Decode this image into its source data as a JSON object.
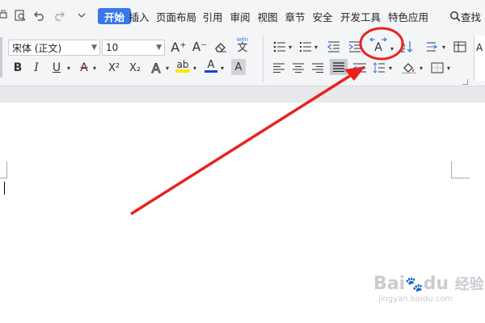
{
  "menubar": {
    "tabs": [
      {
        "label": "开始",
        "active": true
      },
      {
        "label": "插入"
      },
      {
        "label": "页面布局"
      },
      {
        "label": "引用"
      },
      {
        "label": "审阅"
      },
      {
        "label": "视图"
      },
      {
        "label": "章节"
      },
      {
        "label": "安全"
      },
      {
        "label": "开发工具"
      },
      {
        "label": "特色应用"
      }
    ],
    "search_label": "查找"
  },
  "font": {
    "name": "宋体 (正文)",
    "size": "10"
  },
  "format": {
    "bold": "B",
    "italic": "I",
    "underline": "U",
    "strike": "A",
    "superscript": "X²",
    "subscript": "X₂",
    "effects": "A",
    "highlight": "ab",
    "font_color": "A",
    "shading": "A",
    "grow": "A⁺",
    "shrink": "A⁻",
    "phonetic": "文",
    "phonetic_top": "wén"
  },
  "paragraph": {
    "char_spacing": "A",
    "sort": "A"
  },
  "colors": {
    "accent": "#3a78e7",
    "annotation": "#e8231f",
    "highlight": "#ffe600",
    "font_color": "#1a3ee0"
  },
  "watermark": {
    "brand": "Bai",
    "brand2": "du",
    "suffix": "经验",
    "url": "jingyan.baidu.com"
  }
}
